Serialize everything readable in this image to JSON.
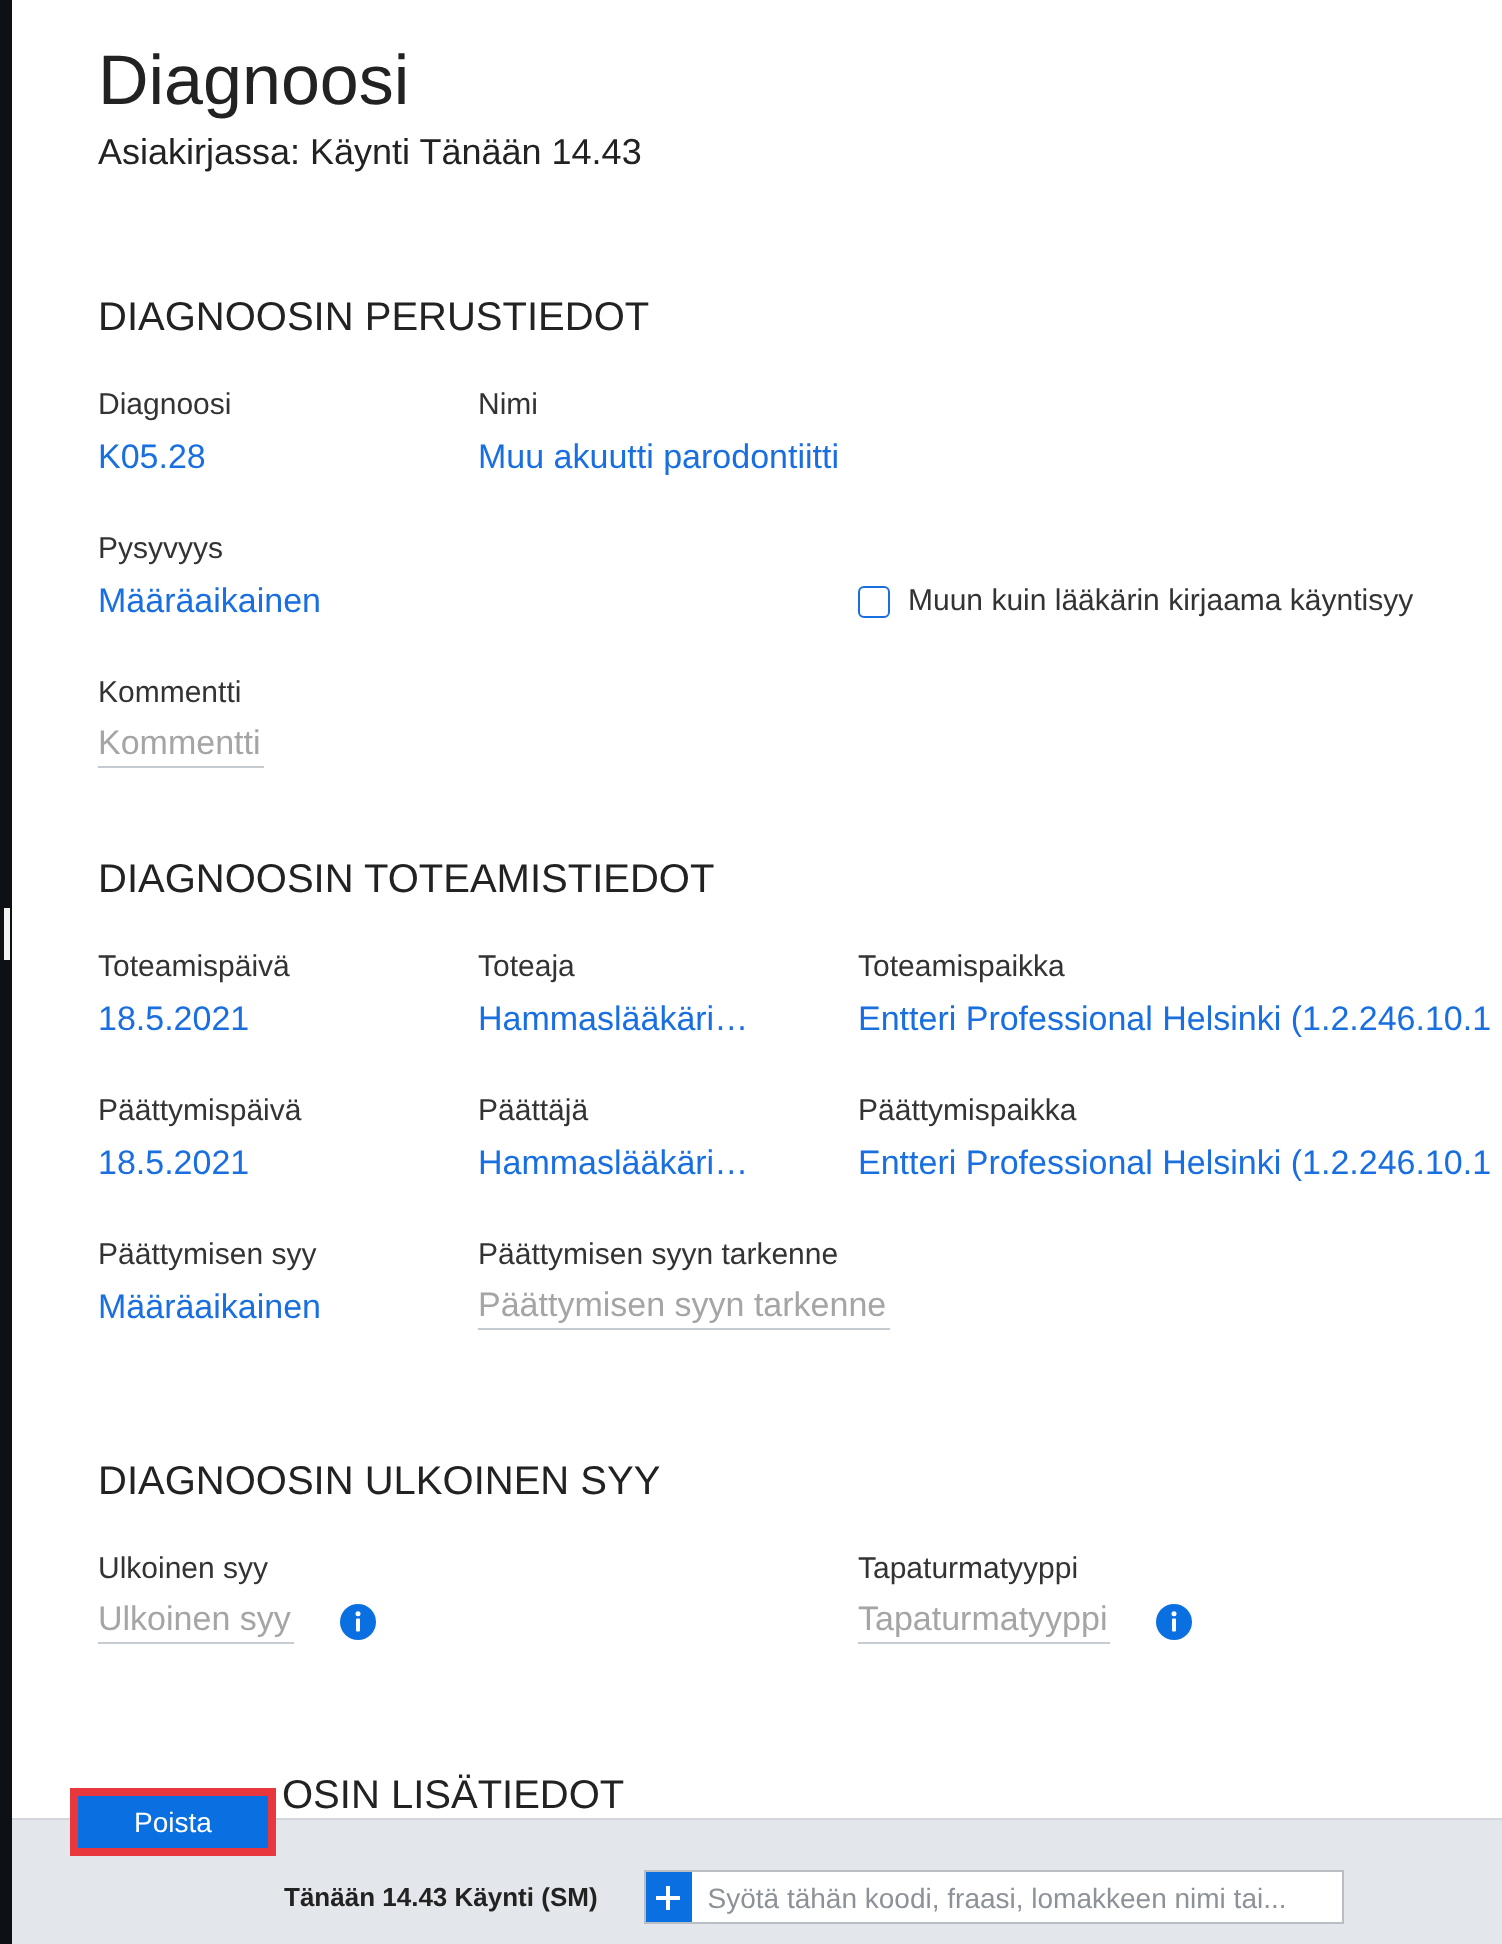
{
  "page": {
    "title": "Diagnoosi",
    "subtitle": "Asiakirjassa: Käynti Tänään 14.43"
  },
  "sections": [
    {
      "heading": "DIAGNOOSIN PERUSTIEDOT",
      "rows": [
        {
          "fields": [
            {
              "kind": "value",
              "label": "Diagnoosi",
              "value": "K05.28"
            },
            {
              "kind": "value",
              "label": "Nimi",
              "value": "Muu akuutti parodontiitti"
            }
          ]
        },
        {
          "fields": [
            {
              "kind": "value",
              "label": "Pysyvyys",
              "value": "Määräaikainen"
            },
            {
              "kind": "checkbox",
              "label": "Muun kuin lääkärin kirjaama käyntisyy",
              "checked": false
            }
          ]
        },
        {
          "fields": [
            {
              "kind": "input",
              "label": "Kommentti",
              "placeholder": "Kommentti",
              "info_icon": false
            }
          ]
        }
      ]
    },
    {
      "heading": "DIAGNOOSIN TOTEAMISTIEDOT",
      "rows": [
        {
          "fields": [
            {
              "kind": "value",
              "label": "Toteamispäivä",
              "value": "18.5.2021"
            },
            {
              "kind": "value",
              "label": "Toteaja",
              "value": "Hammaslääkäri…"
            },
            {
              "kind": "value",
              "label": "Toteamispaikka",
              "value": "Entteri Professional Helsinki (1.2.246.10.1"
            }
          ]
        },
        {
          "fields": [
            {
              "kind": "value",
              "label": "Päättymispäivä",
              "value": "18.5.2021"
            },
            {
              "kind": "value",
              "label": "Päättäjä",
              "value": "Hammaslääkäri…"
            },
            {
              "kind": "value",
              "label": "Päättymispaikka",
              "value": "Entteri Professional Helsinki (1.2.246.10.1"
            }
          ]
        },
        {
          "fields": [
            {
              "kind": "value",
              "label": "Päättymisen syy",
              "value": "Määräaikainen"
            },
            {
              "kind": "input",
              "label": "Päättymisen syyn tarkenne",
              "placeholder": "Päättymisen syyn tarkenne",
              "info_icon": false
            }
          ]
        }
      ]
    },
    {
      "heading": "DIAGNOOSIN ULKOINEN SYY",
      "rows": [
        {
          "fields": [
            {
              "kind": "input",
              "label": "Ulkoinen syy",
              "placeholder": "Ulkoinen syy",
              "info_icon": true
            },
            {
              "kind": "input",
              "label": "Tapaturmatyyppi",
              "placeholder": "Tapaturmatyyppi",
              "info_icon": true
            }
          ]
        }
      ]
    },
    {
      "heading": "OSIN LISÄTIEDOT"
    }
  ],
  "delete_button": {
    "label": "Poista",
    "highlighted": true
  },
  "bottom_bar": {
    "visit": "Tänään 14.43 Käynti (SM)",
    "search": {
      "placeholder": "Syötä tähän koodi, fraasi, lomakkeen nimi tai..."
    }
  }
}
